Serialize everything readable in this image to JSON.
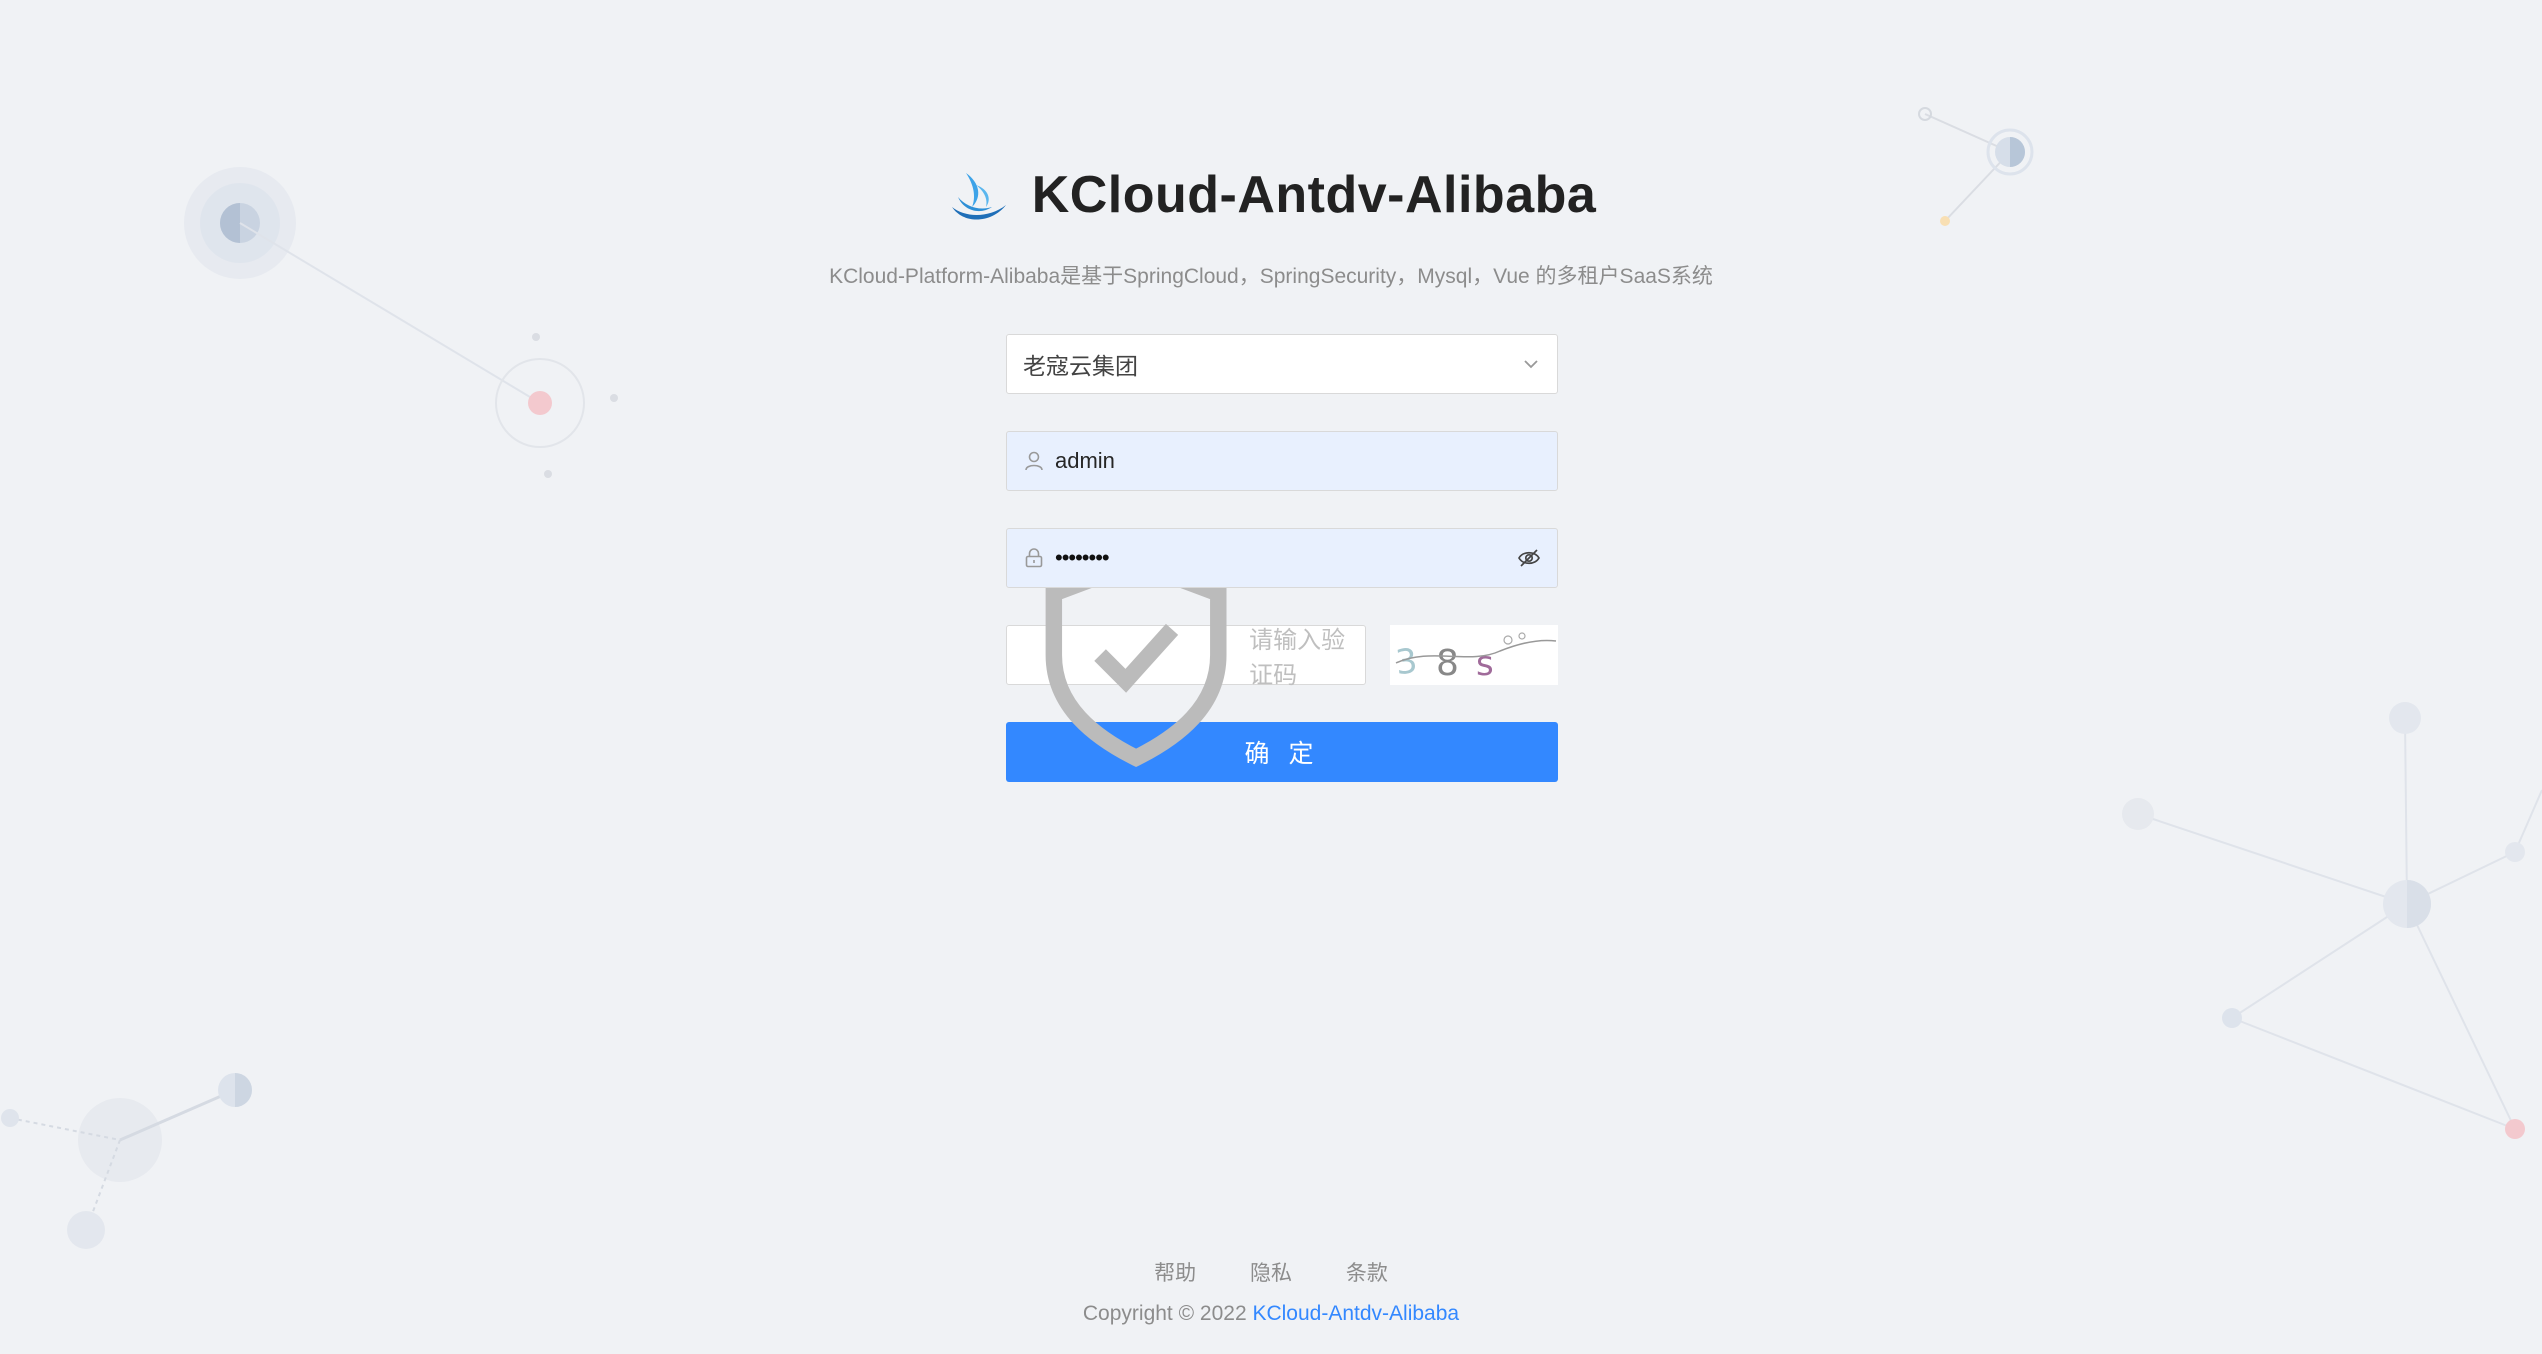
{
  "header": {
    "title": "KCloud-Antdv-Alibaba",
    "subtitle": "KCloud-Platform-Alibaba是基于SpringCloud，SpringSecurity，Mysql，Vue 的多租户SaaS系统",
    "logo_icon": "wave-logo-icon"
  },
  "form": {
    "tenant_select": {
      "selected": "老寇云集团"
    },
    "username": {
      "value": "admin",
      "icon": "user-icon"
    },
    "password": {
      "masked_value": "••••••••",
      "icon": "lock-icon",
      "toggle_icon": "eye-invisible-icon"
    },
    "captcha": {
      "placeholder": "请输入验证码",
      "icon": "safety-icon",
      "image_text": "38s"
    },
    "submit_label": "确 定"
  },
  "footer": {
    "links": [
      "帮助",
      "隐私",
      "条款"
    ],
    "copyright_prefix": "Copyright © 2022 ",
    "copyright_brand": "KCloud-Antdv-Alibaba"
  },
  "colors": {
    "primary": "#3388ff",
    "background": "#f0f2f5",
    "autofill": "#e8f0fe"
  }
}
